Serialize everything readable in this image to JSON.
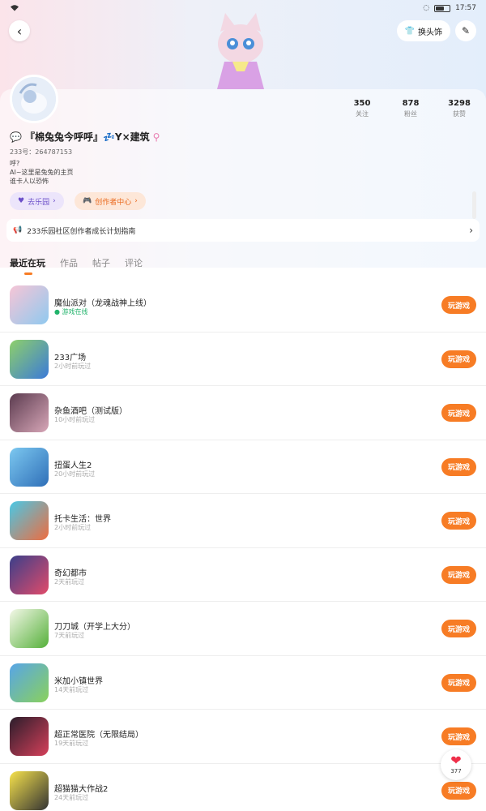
{
  "status_bar": {
    "time": "17:57"
  },
  "header": {
    "back_icon": "back-icon",
    "pill_label": "换头饰",
    "edit_icon": "edit-icon"
  },
  "profile": {
    "stats": [
      {
        "value": "350",
        "label": "关注"
      },
      {
        "value": "878",
        "label": "粉丝"
      },
      {
        "value": "3298",
        "label": "获赞"
      }
    ],
    "name": "『棉兔兔今呼呼』💤Y×建筑",
    "uid": "233号：264787153",
    "bio_lines": [
      "呼?",
      "AI~这里是兔兔的主页",
      "谁卡人以恐怖"
    ],
    "tags": [
      {
        "label": "去乐园",
        "color": "#6b4fc9"
      },
      {
        "label": "创作者中心",
        "color": "#ea6a1f"
      }
    ],
    "notice": "233乐园社区创作者成长计划指南"
  },
  "tabs": [
    {
      "label": "最近在玩",
      "active": true
    },
    {
      "label": "作品"
    },
    {
      "label": "帖子"
    },
    {
      "label": "评论"
    }
  ],
  "play_label": "玩游戏",
  "games": [
    {
      "title": "魔仙派对（龙魂战神上线）",
      "sub": "● 游戏在线",
      "sub_green": true,
      "colors": [
        "#f7c5d6",
        "#8fc9ef"
      ]
    },
    {
      "title": "233广场",
      "sub": "2小时前玩过",
      "colors": [
        "#8ed06a",
        "#3b7ad8"
      ]
    },
    {
      "title": "杂鱼酒吧（测试版）",
      "sub": "10小时前玩过",
      "colors": [
        "#5b3b4f",
        "#d8a7b8"
      ]
    },
    {
      "title": "扭蛋人生2",
      "sub": "20小时前玩过",
      "colors": [
        "#7cc8f0",
        "#2f6fb8"
      ]
    },
    {
      "title": "托卡生活：世界",
      "sub": "2小时前玩过",
      "colors": [
        "#49c8e6",
        "#ef6c3f"
      ]
    },
    {
      "title": "奇幻都市",
      "sub": "2天前玩过",
      "colors": [
        "#3a3f8a",
        "#e24b6a"
      ]
    },
    {
      "title": "刀刀城（开学上大分）",
      "sub": "7天前玩过",
      "colors": [
        "#f4f8e8",
        "#55b03a"
      ]
    },
    {
      "title": "米加小镇世界",
      "sub": "14天前玩过",
      "colors": [
        "#57a5e8",
        "#8ad15b"
      ]
    },
    {
      "title": "超正常医院（无限结局）",
      "sub": "19天前玩过",
      "colors": [
        "#2a1d2b",
        "#d6405a"
      ]
    },
    {
      "title": "超猫猫大作战2",
      "sub": "24天前玩过",
      "colors": [
        "#f6e24c",
        "#333"
      ]
    }
  ],
  "like_count": "377"
}
